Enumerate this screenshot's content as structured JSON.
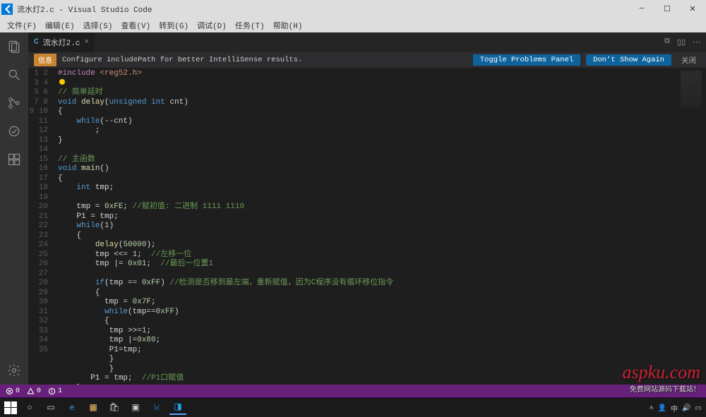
{
  "titlebar": {
    "title": "流水灯2.c - Visual Studio Code"
  },
  "menubar": [
    "文件(F)",
    "编辑(E)",
    "选择(S)",
    "查看(V)",
    "转到(G)",
    "调试(D)",
    "任务(T)",
    "帮助(H)"
  ],
  "tab": {
    "icon": "C",
    "label": "流水灯2.c"
  },
  "notification": {
    "badge": "信息",
    "text": "Configure includePath for better IntelliSense results.",
    "btn1": "Toggle Problems Panel",
    "btn2": "Don't Show Again",
    "close": "关闭"
  },
  "code_lines": [
    {
      "n": 1,
      "html": "<span class='inc'>#include</span> <span class='str'>&lt;reg52.h&gt;</span>"
    },
    {
      "n": 2,
      "html": "<span class='bulb'></span>"
    },
    {
      "n": 3,
      "html": "<span class='cmt'>// 简单延时</span>"
    },
    {
      "n": 4,
      "html": "<span class='kw'>void</span> <span class='fn'>delay</span>(<span class='kw'>unsigned</span> <span class='kw'>int</span> cnt)"
    },
    {
      "n": 5,
      "html": "{"
    },
    {
      "n": 6,
      "html": "    <span class='kw'>while</span>(--cnt)"
    },
    {
      "n": 7,
      "html": "        ;"
    },
    {
      "n": 8,
      "html": "}"
    },
    {
      "n": 9,
      "html": ""
    },
    {
      "n": 10,
      "html": "<span class='cmt'>// 主函数</span>"
    },
    {
      "n": 11,
      "html": "<span class='kw'>void</span> <span class='fn'>main</span>()"
    },
    {
      "n": 12,
      "html": "{"
    },
    {
      "n": 13,
      "html": "    <span class='kw'>int</span> tmp;"
    },
    {
      "n": 14,
      "html": ""
    },
    {
      "n": 15,
      "html": "    tmp = <span class='num'>0xFE</span>; <span class='cmt'>//赋初值: 二进制 1111 1110</span>"
    },
    {
      "n": 16,
      "html": "    P1 = tmp;"
    },
    {
      "n": 17,
      "html": "    <span class='kw'>while</span>(<span class='num'>1</span>)"
    },
    {
      "n": 18,
      "html": "    {"
    },
    {
      "n": 19,
      "html": "        <span class='fn'>delay</span>(<span class='num'>50000</span>);"
    },
    {
      "n": 20,
      "html": "        tmp &lt;&lt;= <span class='num'>1</span>;  <span class='cmt'>//左移一位</span>"
    },
    {
      "n": 21,
      "html": "        tmp |= <span class='num'>0x01</span>;  <span class='cmt'>//最后一位置1</span>"
    },
    {
      "n": 22,
      "html": ""
    },
    {
      "n": 23,
      "html": "        <span class='kw'>if</span>(tmp == <span class='num'>0xFF</span>) <span class='cmt'>//检测是否移到最左端，重新赋值，因为C程序没有循环移位指令</span>"
    },
    {
      "n": 24,
      "html": "        {"
    },
    {
      "n": 25,
      "html": "          tmp = <span class='num'>0x7F</span>;"
    },
    {
      "n": 26,
      "html": "          <span class='kw'>while</span>(tmp==<span class='num'>0xFF</span>)"
    },
    {
      "n": 27,
      "html": "          {"
    },
    {
      "n": 28,
      "html": "           tmp &gt;&gt;=<span class='num'>1</span>;"
    },
    {
      "n": 29,
      "html": "           tmp |=<span class='num'>0x80</span>;"
    },
    {
      "n": 30,
      "html": "           P1=tmp;"
    },
    {
      "n": 31,
      "html": "           }"
    },
    {
      "n": 32,
      "html": "           }"
    },
    {
      "n": 33,
      "html": "       P1 = tmp;  <span class='cmt'>//P1口赋值</span>"
    },
    {
      "n": 34,
      "html": "    }"
    },
    {
      "n": 35,
      "html": "}"
    }
  ],
  "statusbar": {
    "errors": "0",
    "warnings": "0",
    "info": "1"
  },
  "watermark": {
    "main": "aspku.com",
    "sub": "免费网站源码下载站！"
  }
}
